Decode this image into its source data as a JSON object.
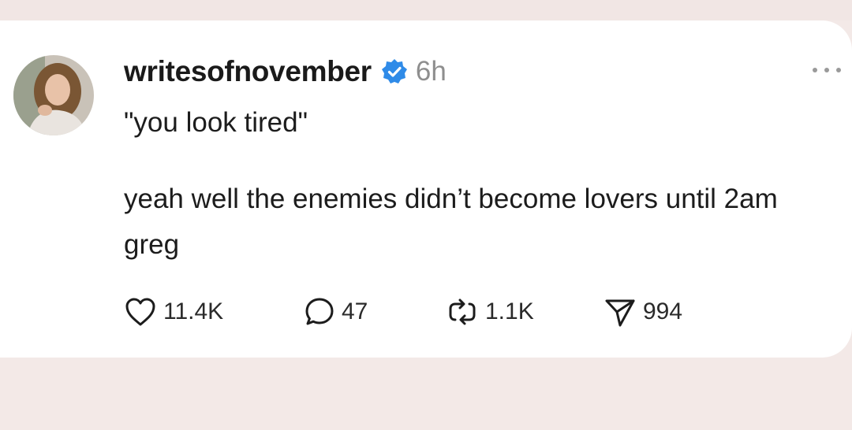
{
  "post": {
    "username": "writesofnovember",
    "time": "6h",
    "quote_line": "\"you look tired\"",
    "body": "yeah well the enemies didn’t become lovers until 2am greg"
  },
  "actions": {
    "likes": "11.4K",
    "comments": "47",
    "reposts": "1.1K",
    "shares": "994"
  },
  "icons": {
    "verified": "verified-badge-icon",
    "like": "heart-icon",
    "comment": "speech-bubble-icon",
    "repost": "repost-arrows-icon",
    "share": "paper-plane-icon",
    "more": "more-dots-icon"
  },
  "colors": {
    "page_background": "#f3e9e7",
    "card_background": "#ffffff",
    "verified_blue": "#2f8be8",
    "muted_text": "#8e8e8e"
  }
}
